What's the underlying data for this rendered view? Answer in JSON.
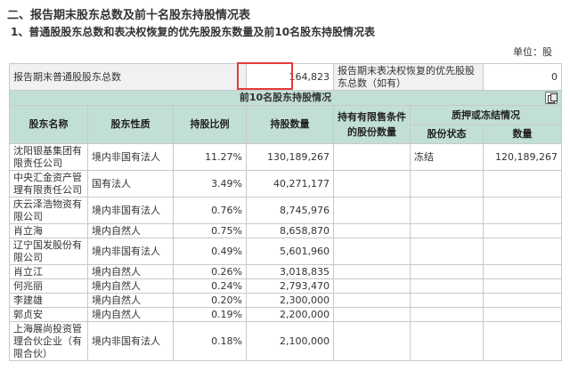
{
  "heading": "二、报告期末股东总数及前十名股东持股情况表",
  "subheading": "1、普通股股东总数和表决权恢复的优先股股东数量及前10名股东持股情况表",
  "unit": "单位：股",
  "summary": {
    "common_label": "报告期末普通股股东总数",
    "common_value": "164,823",
    "preferred_label": "报告期末表决权恢复的优先股股东总数（如有）",
    "preferred_value": "0"
  },
  "top10_title": "前10名股东持股情况",
  "headers": {
    "name": "股东名称",
    "nature": "股东性质",
    "ratio": "持股比例",
    "qty": "持股数量",
    "restricted": "持有有限售条件的股份数量",
    "pledge": "质押或冻结情况",
    "pledge_status": "股份状态",
    "pledge_qty": "数量"
  },
  "rows": [
    {
      "name": "沈阳银基集团有限责任公司",
      "nature": "境内非国有法人",
      "ratio": "11.27%",
      "qty": "130,189,267",
      "restricted": "",
      "status": "冻结",
      "pqty": "120,189,267"
    },
    {
      "name": "中央汇金资产管理有限责任公司",
      "nature": "国有法人",
      "ratio": "3.49%",
      "qty": "40,271,177",
      "restricted": "",
      "status": "",
      "pqty": ""
    },
    {
      "name": "庆云泽浩物资有限公司",
      "nature": "境内非国有法人",
      "ratio": "0.76%",
      "qty": "8,745,976",
      "restricted": "",
      "status": "",
      "pqty": ""
    },
    {
      "name": "肖立海",
      "nature": "境内自然人",
      "ratio": "0.75%",
      "qty": "8,658,870",
      "restricted": "",
      "status": "",
      "pqty": ""
    },
    {
      "name": "辽宁国发股份有限公司",
      "nature": "境内非国有法人",
      "ratio": "0.49%",
      "qty": "5,601,960",
      "restricted": "",
      "status": "",
      "pqty": ""
    },
    {
      "name": "肖立江",
      "nature": "境内自然人",
      "ratio": "0.26%",
      "qty": "3,018,835",
      "restricted": "",
      "status": "",
      "pqty": ""
    },
    {
      "name": "何兆丽",
      "nature": "境内自然人",
      "ratio": "0.24%",
      "qty": "2,793,470",
      "restricted": "",
      "status": "",
      "pqty": ""
    },
    {
      "name": "李建雄",
      "nature": "境内自然人",
      "ratio": "0.20%",
      "qty": "2,300,000",
      "restricted": "",
      "status": "",
      "pqty": ""
    },
    {
      "name": "郭贞安",
      "nature": "境内自然人",
      "ratio": "0.19%",
      "qty": "2,200,000",
      "restricted": "",
      "status": "",
      "pqty": ""
    },
    {
      "name": "上海展尚投资管理合伙企业（有限合伙）",
      "nature": "境内非国有法人",
      "ratio": "0.18%",
      "qty": "2,100,000",
      "restricted": "",
      "status": "",
      "pqty": ""
    }
  ],
  "colors": {
    "header_bg": "#c2dfd6",
    "highlight_border": "#e23b3b",
    "label_bg": "#f1f1f1"
  },
  "icons": {
    "copy": "copy-icon"
  }
}
